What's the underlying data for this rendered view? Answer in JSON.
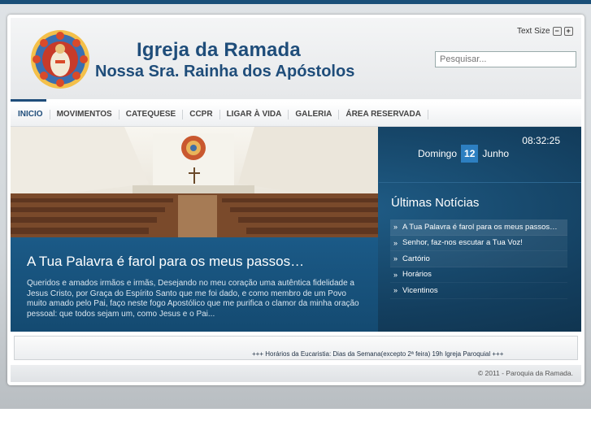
{
  "header": {
    "title": "Igreja da Ramada",
    "subtitle": "Nossa Sra. Rainha dos Apóstolos",
    "text_size_label": "Text Size",
    "decrease_label": "−",
    "increase_label": "+",
    "search_placeholder": "Pesquisar..."
  },
  "nav": {
    "items": [
      {
        "label": "INICIO"
      },
      {
        "label": "MOVIMENTOS"
      },
      {
        "label": "CATEQUESE"
      },
      {
        "label": "CCPR"
      },
      {
        "label": "LIGAR À VIDA"
      },
      {
        "label": "GALERIA"
      },
      {
        "label": "ÁREA RESERVADA"
      }
    ]
  },
  "feature": {
    "title": "A Tua Palavra é farol para os meus passos…",
    "text": "Queridos e amados irmãos e irmãs, Desejando no meu coração uma autêntica fidelidade a Jesus Cristo, por Graça do Espírito Santo que me foi dado, e como membro de um Povo muito amado pelo Pai, faço neste fogo Apostólico que me purifica o clamor da minha oração pessoal: que todos sejam um, como Jesus e o Pai..."
  },
  "sidebar": {
    "time": "08:32:25",
    "weekday": "Domingo",
    "day": "12",
    "month": "Junho",
    "news_title": "Últimas Notícias",
    "news": [
      {
        "label": "A Tua Palavra é farol para os meus passos…"
      },
      {
        "label": "Senhor, faz-nos escutar a Tua Voz!"
      },
      {
        "label": "Cartório"
      },
      {
        "label": "Horários"
      },
      {
        "label": "Vicentinos"
      }
    ],
    "arrow": "»"
  },
  "ticker": {
    "text": "+++ Horários da Eucaristia: Dias da Semana(excepto 2ª feira) 19h Igreja Paroquial +++"
  },
  "footer": {
    "text": "© 2011 - Paroquia da Ramada."
  },
  "colors": {
    "brand": "#1f4d7a",
    "feature_bg": "#133e5e",
    "highlight": "#2d7fc1"
  }
}
